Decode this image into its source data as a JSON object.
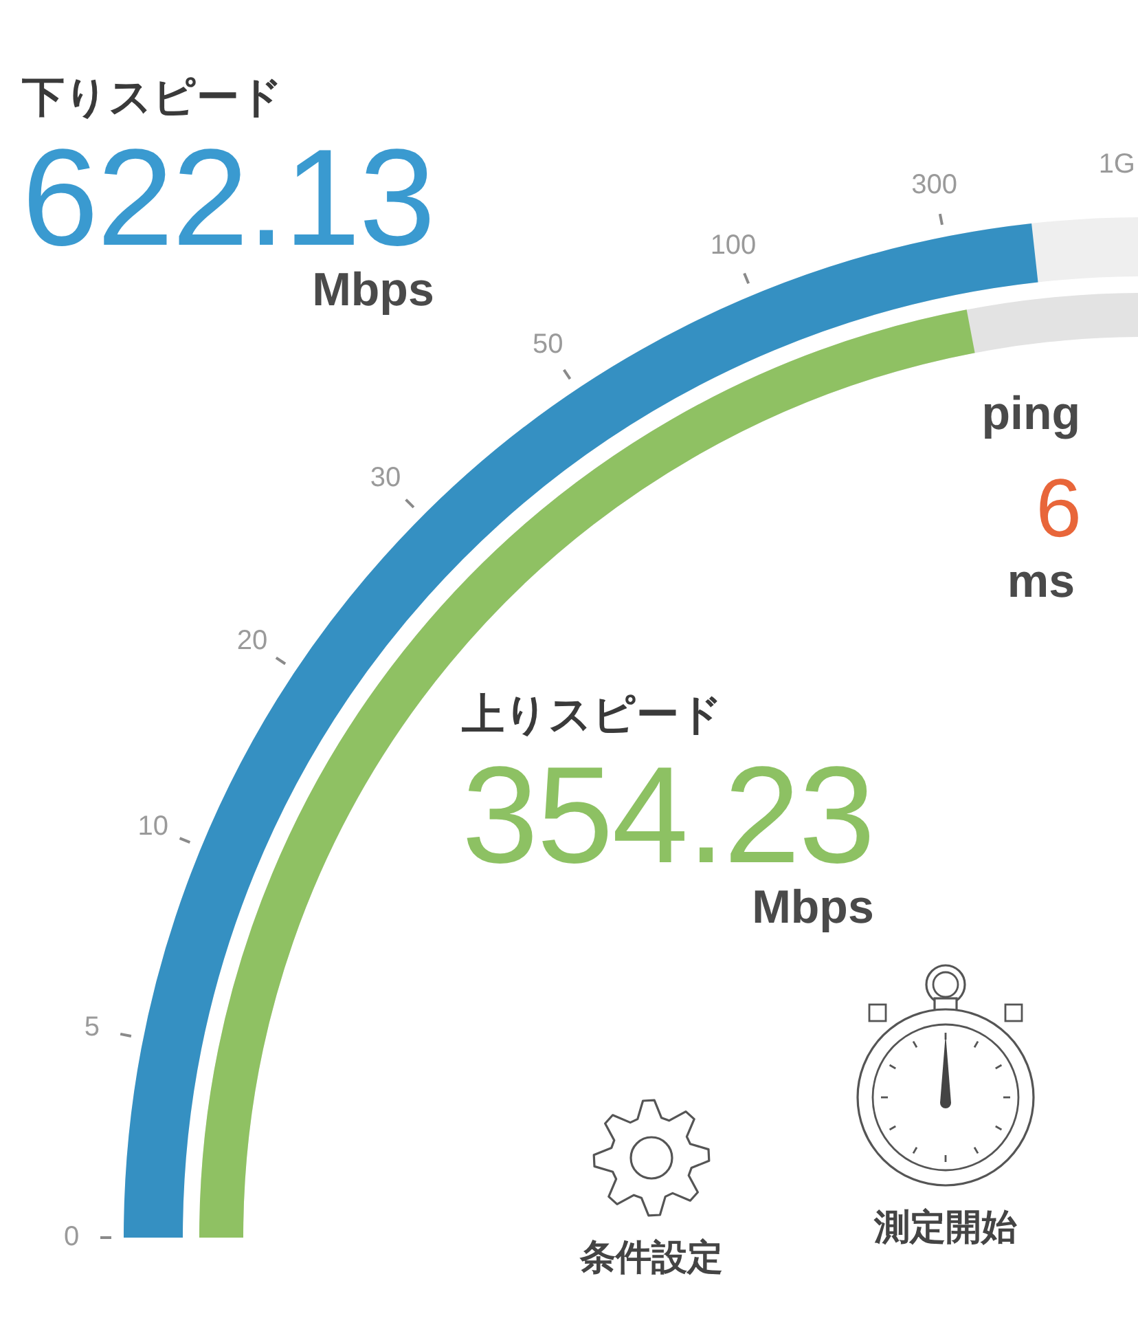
{
  "download": {
    "label": "下りスピード",
    "value": "622.13",
    "unit": "Mbps"
  },
  "upload": {
    "label": "上りスピード",
    "value": "354.23",
    "unit": "Mbps"
  },
  "ping": {
    "label": "ping",
    "value": "6",
    "unit": "ms"
  },
  "scale_labels": [
    "0",
    "5",
    "10",
    "20",
    "30",
    "50",
    "100",
    "300",
    "1G"
  ],
  "buttons": [
    {
      "kind": "settings",
      "label": "条件設定"
    },
    {
      "kind": "start",
      "label": "測定開始"
    }
  ]
}
